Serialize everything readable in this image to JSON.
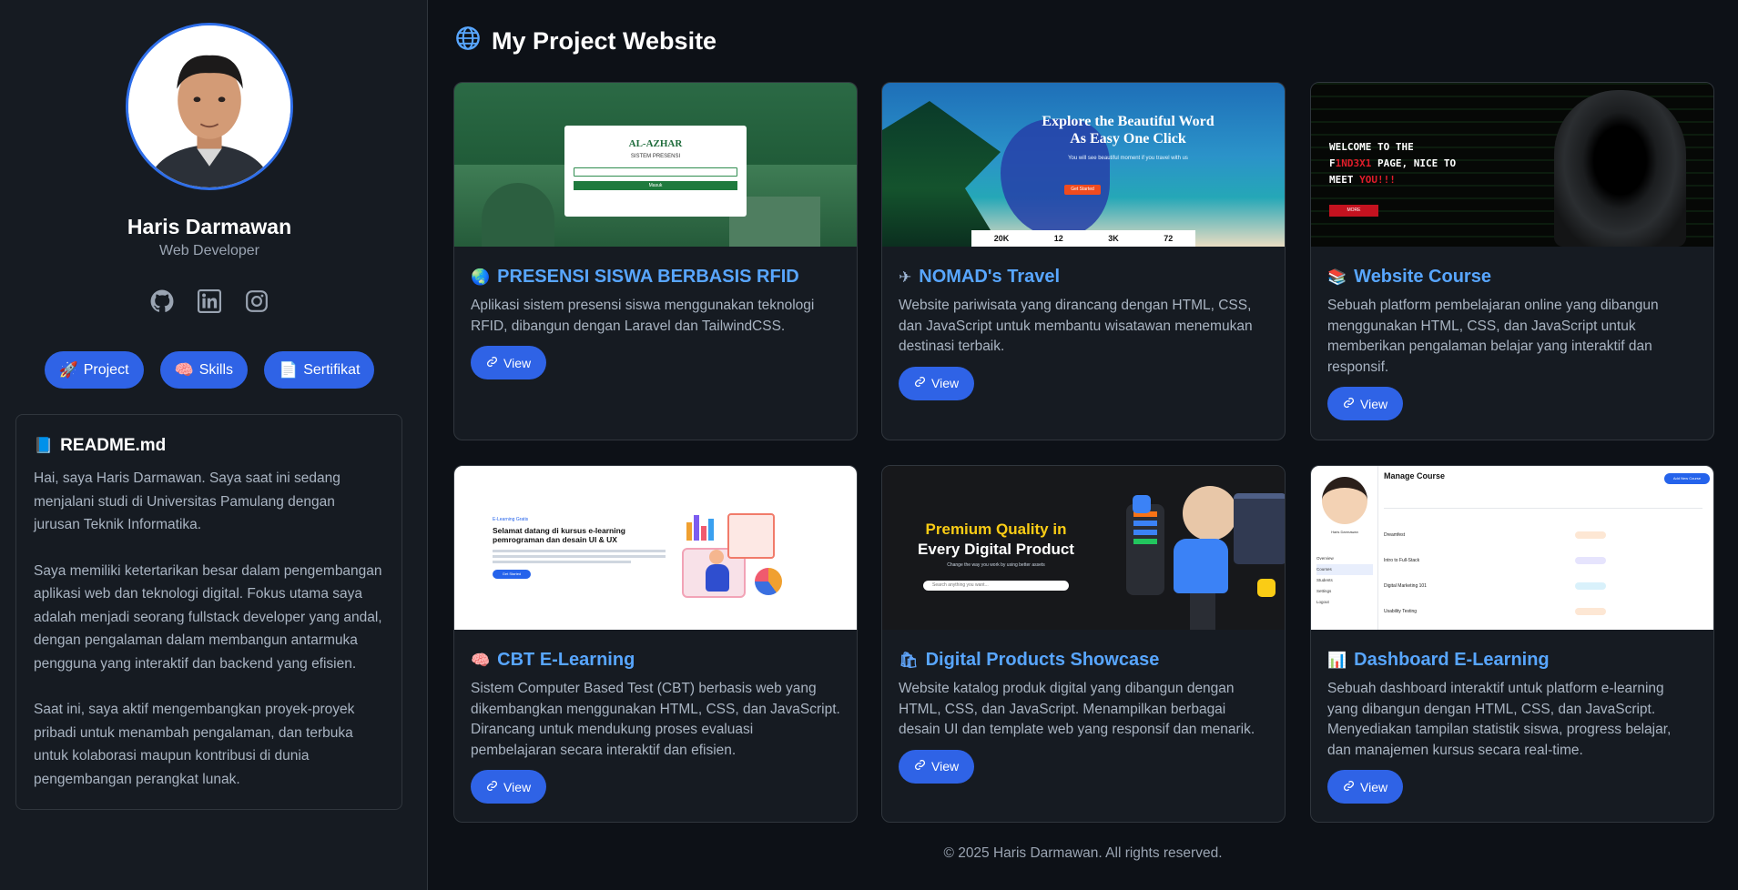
{
  "profile": {
    "name": "Haris Darmawan",
    "role": "Web Developer",
    "socials": [
      "github-icon",
      "linkedin-icon",
      "instagram-icon"
    ]
  },
  "nav": [
    {
      "icon": "🚀",
      "label": "Project"
    },
    {
      "icon": "🧠",
      "label": "Skills"
    },
    {
      "icon": "📄",
      "label": "Sertifikat"
    }
  ],
  "readme": {
    "icon": "📘",
    "title": "README.md",
    "paragraphs": [
      "Hai, saya Haris Darmawan. Saya saat ini sedang menjalani studi di Universitas Pamulang dengan jurusan Teknik Informatika.",
      "Saya memiliki ketertarikan besar dalam pengembangan aplikasi web dan teknologi digital. Fokus utama saya adalah menjadi seorang fullstack developer yang andal, dengan pengalaman dalam membangun antarmuka pengguna yang interaktif dan backend yang efisien.",
      "Saat ini, saya aktif mengembangkan proyek-proyek pribadi untuk menambah pengalaman, dan terbuka untuk kolaborasi maupun kontribusi di dunia pengembangan perangkat lunak."
    ]
  },
  "main": {
    "icon": "🌐",
    "title": "My Project Website"
  },
  "projects": [
    {
      "icon": "🌏",
      "title": "PRESENSI SISWA BERBASIS RFID",
      "desc": "Aplikasi sistem presensi siswa menggunakan teknologi RFID, dibangun dengan Laravel dan TailwindCSS.",
      "button": "View"
    },
    {
      "icon": "✈",
      "title": "NOMAD's Travel",
      "desc": "Website pariwisata yang dirancang dengan HTML, CSS, dan JavaScript untuk membantu wisatawan menemukan destinasi terbaik.",
      "button": "View"
    },
    {
      "icon": "📚",
      "title": "Website Course",
      "desc": "Sebuah platform pembelajaran online yang dibangun menggunakan HTML, CSS, dan JavaScript untuk memberikan pengalaman belajar yang interaktif dan responsif.",
      "button": "View"
    },
    {
      "icon": "🧠",
      "title": "CBT E-Learning",
      "desc": "Sistem Computer Based Test (CBT) berbasis web yang dikembangkan menggunakan HTML, CSS, dan JavaScript. Dirancang untuk mendukung proses evaluasi pembelajaran secara interaktif dan efisien.",
      "button": "View"
    },
    {
      "icon": "🛍",
      "title": "Digital Products Showcase",
      "desc": "Website katalog produk digital yang dibangun dengan HTML, CSS, dan JavaScript. Menampilkan berbagai desain UI dan template web yang responsif dan menarik.",
      "button": "View"
    },
    {
      "icon": "📊",
      "title": "Dashboard E-Learning",
      "desc": "Sebuah dashboard interaktif untuk platform e-learning yang dibangun dengan HTML, CSS, dan JavaScript. Menyediakan tampilan statistik siswa, progress belajar, dan manajemen kursus secara real-time.",
      "button": "View"
    }
  ],
  "thumbs": {
    "rfid": {
      "brand": "AL-AZHAR",
      "subtitle": "SISTEM PRESENSI",
      "button": "Masuk"
    },
    "nomad": {
      "headline1": "Explore the Beautiful Word",
      "headline2": "As Easy One Click",
      "tagline": "You will see beautiful moment if you travel with us",
      "cta": "Get Started",
      "stats": [
        "20K",
        "12",
        "3K",
        "72"
      ]
    },
    "course": {
      "line1": "WELCOME TO THE",
      "line2a": "F",
      "line2b": "1ND3X1",
      "line2c": " PAGE, NICE TO",
      "line3a": "MEET ",
      "line3b": "YOU!!!",
      "cta": "MORE"
    },
    "cbt": {
      "kicker": "E-Learning Gratis",
      "head1": "Selamat datang di kursus e-learning",
      "head2": "pemrograman dan desain UI & UX",
      "cta": "Get Started"
    },
    "digital": {
      "line1": "Premium Quality in",
      "line2": "Every Digital Product",
      "sub": "Change the way you work by using better assets",
      "search": "Search anything you want..."
    },
    "dash": {
      "title": "Manage Course",
      "add": "Add New Course",
      "profile": "Haris Darmawan",
      "rows": [
        "Dreamfest",
        "Intro to Full-Stack",
        "Digital Marketing 101",
        "Usability Testing"
      ],
      "menu": [
        "Overview",
        "Courses",
        "Students",
        "Settings",
        "Logout"
      ]
    }
  },
  "footer": "© 2025 Haris Darmawan. All rights reserved.",
  "colors": {
    "accent": "#2f63e6",
    "link": "#58a6ff",
    "bg": "#0d1117",
    "panel": "#161b22"
  }
}
